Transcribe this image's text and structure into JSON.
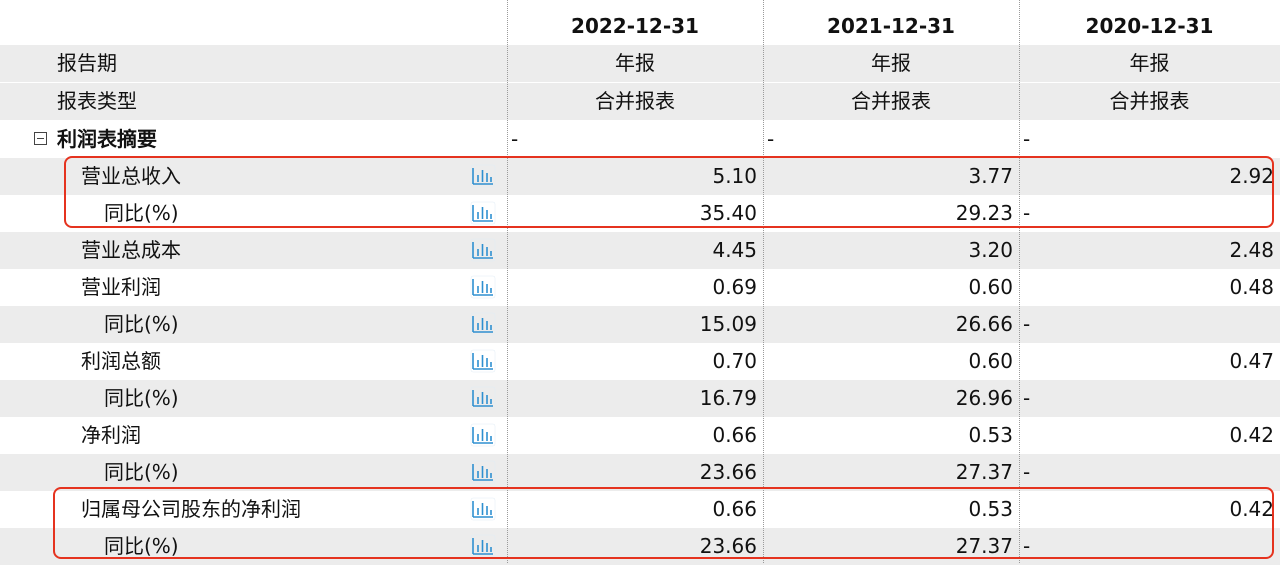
{
  "header": {
    "dates": [
      "2022-12-31",
      "2021-12-31",
      "2020-12-31"
    ],
    "report_period_label": "报告期",
    "report_period_values": [
      "年报",
      "年报",
      "年报"
    ],
    "report_type_label": "报表类型",
    "report_type_values": [
      "合并报表",
      "合并报表",
      "合并报表"
    ]
  },
  "section": {
    "title": "利润表摘要",
    "values": [
      "-",
      "-",
      "-"
    ]
  },
  "rows": [
    {
      "label": "营业总收入",
      "values": [
        "5.10",
        "3.77",
        "2.92"
      ]
    },
    {
      "label": "同比(%)",
      "values": [
        "35.40",
        "29.23",
        "-"
      ]
    },
    {
      "label": "营业总成本",
      "values": [
        "4.45",
        "3.20",
        "2.48"
      ]
    },
    {
      "label": "营业利润",
      "values": [
        "0.69",
        "0.60",
        "0.48"
      ]
    },
    {
      "label": "同比(%)",
      "values": [
        "15.09",
        "26.66",
        "-"
      ]
    },
    {
      "label": "利润总额",
      "values": [
        "0.70",
        "0.60",
        "0.47"
      ]
    },
    {
      "label": "同比(%)",
      "values": [
        "16.79",
        "26.96",
        "-"
      ]
    },
    {
      "label": "净利润",
      "values": [
        "0.66",
        "0.53",
        "0.42"
      ]
    },
    {
      "label": "同比(%)",
      "values": [
        "23.66",
        "27.37",
        "-"
      ]
    },
    {
      "label": "归属母公司股东的净利润",
      "values": [
        "0.66",
        "0.53",
        "0.42"
      ]
    },
    {
      "label": "同比(%)",
      "values": [
        "23.66",
        "27.37",
        "-"
      ]
    }
  ],
  "icons": {
    "row_chart": "bar-chart-icon",
    "collapse": "collapse-toggle-icon"
  },
  "colors": {
    "highlight_border": "#e5331f",
    "chart_icon": "#2e8fd0",
    "row_shade": "#ececec"
  }
}
